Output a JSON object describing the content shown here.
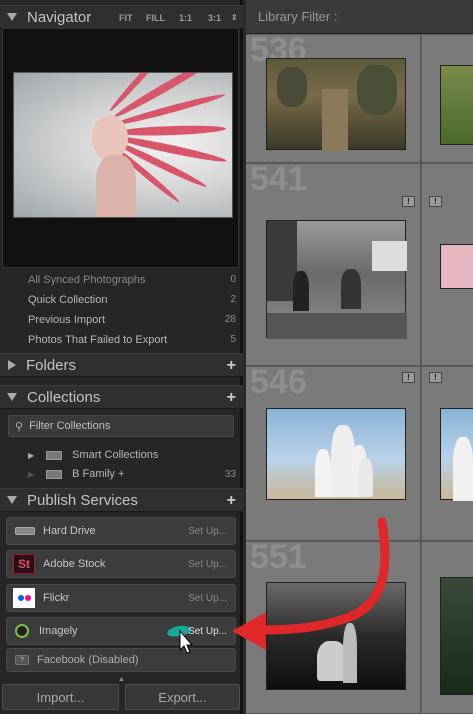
{
  "navigator": {
    "title": "Navigator",
    "tools": [
      "FIT",
      "FILL",
      "1:1",
      "3:1"
    ]
  },
  "catalog_rows": [
    {
      "label": "All Synced Photographs",
      "count": "0"
    },
    {
      "label": "Quick Collection",
      "count": "2"
    },
    {
      "label": "Previous Import",
      "count": "28"
    },
    {
      "label": "Photos That Failed to Export",
      "count": "5"
    }
  ],
  "folders": {
    "title": "Folders"
  },
  "collections": {
    "title": "Collections",
    "filter_placeholder": "Filter Collections",
    "items": [
      {
        "label": "Smart Collections",
        "count": ""
      },
      {
        "label": "B Family  +",
        "count": "33"
      }
    ]
  },
  "publish": {
    "title": "Publish Services",
    "services": [
      {
        "name": "Hard Drive",
        "action": "Set Up..."
      },
      {
        "name": "Adobe Stock",
        "action": "Set Up..."
      },
      {
        "name": "Flickr",
        "action": "Set Up..."
      },
      {
        "name": "Imagely",
        "action": "Set Up..."
      },
      {
        "name": "Facebook (Disabled)",
        "action": ""
      }
    ]
  },
  "buttons": {
    "import": "Import...",
    "export": "Export..."
  },
  "library_filter": {
    "title": "Library Filter :"
  },
  "grid": {
    "numbers": [
      "536",
      "541",
      "546",
      "551"
    ],
    "badge": "!"
  },
  "colors": {
    "arrow": "#e0282a",
    "imagely_accent": "#1aa89a",
    "adobe_st": "#9c1b3a"
  },
  "icons": {
    "search": "magnifier-icon",
    "arrow": "red-curved-arrow",
    "cursor": "mouse-pointer-icon"
  }
}
